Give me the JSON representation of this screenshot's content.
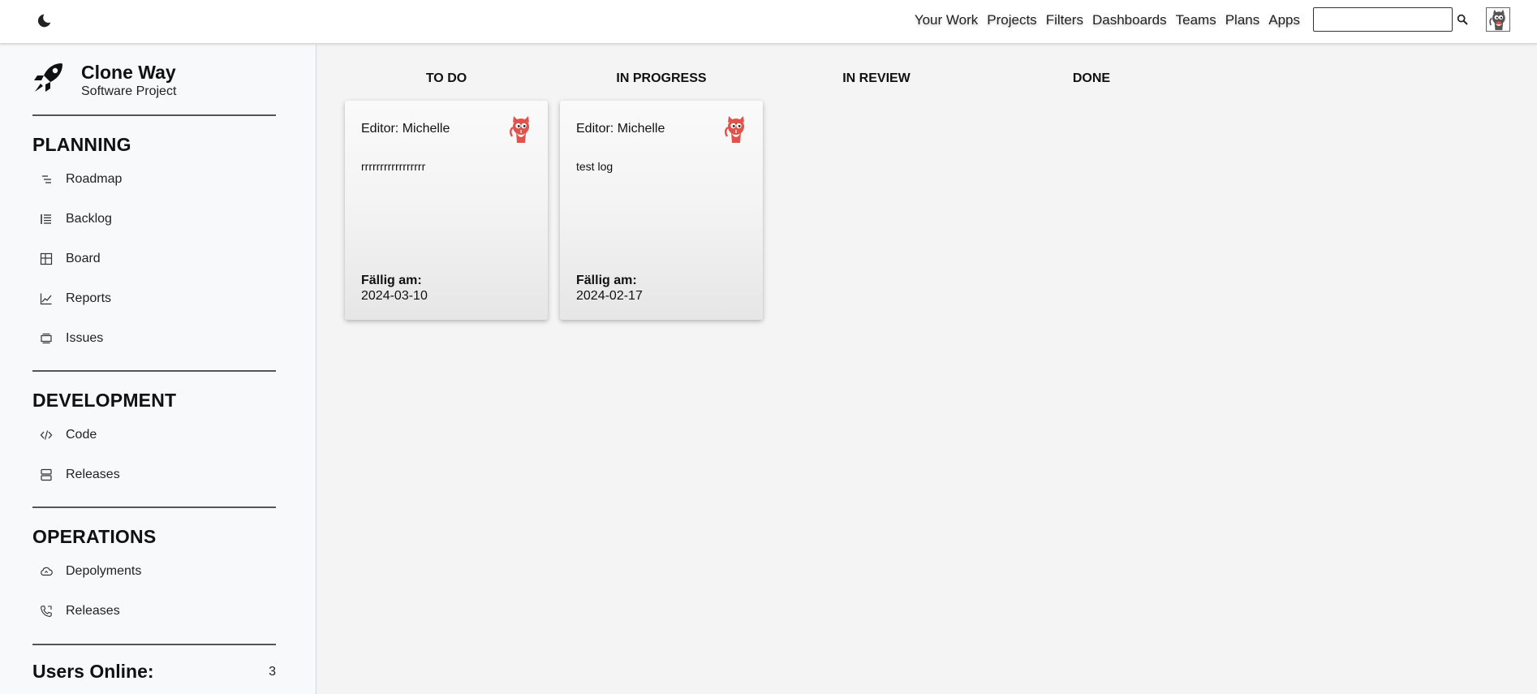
{
  "topbar": {
    "theme_icon": "moon-icon",
    "nav": [
      "Your Work",
      "Projects",
      "Filters",
      "Dashboards",
      "Teams",
      "Plans",
      "Apps"
    ],
    "search": {
      "value": "",
      "placeholder": ""
    }
  },
  "project": {
    "name": "Clone Way",
    "type": "Software Project"
  },
  "sidebar": {
    "planning": {
      "title": "PLANNING",
      "items": [
        {
          "label": "Roadmap",
          "icon": "roadmap-icon"
        },
        {
          "label": "Backlog",
          "icon": "backlog-icon"
        },
        {
          "label": "Board",
          "icon": "board-icon"
        },
        {
          "label": "Reports",
          "icon": "reports-icon"
        },
        {
          "label": "Issues",
          "icon": "issues-icon"
        }
      ]
    },
    "development": {
      "title": "DEVELOPMENT",
      "items": [
        {
          "label": "Code",
          "icon": "code-icon"
        },
        {
          "label": "Releases",
          "icon": "releases-icon"
        }
      ]
    },
    "operations": {
      "title": "OPERATIONS",
      "items": [
        {
          "label": "Depolyments",
          "icon": "cloud-upload-icon"
        },
        {
          "label": "Releases",
          "icon": "phone-icon"
        }
      ]
    },
    "users_online": {
      "label": "Users Online:",
      "count": "3"
    }
  },
  "board": {
    "columns": [
      "TO DO",
      "IN PROGRESS",
      "IN REVIEW",
      "DONE"
    ],
    "cards": [
      {
        "editor": "Editor: Michelle",
        "description": "rrrrrrrrrrrrrrrrr",
        "due_label": "Fällig am:",
        "due_date": "2024-03-10"
      },
      {
        "editor": "Editor: Michelle",
        "description": "test log",
        "due_label": "Fällig am:",
        "due_date": "2024-02-17"
      }
    ]
  },
  "colors": {
    "accent_cat": "#e0524a",
    "page_bg": "#f4f4f4",
    "sidebar_bg": "#f8f9fb"
  }
}
